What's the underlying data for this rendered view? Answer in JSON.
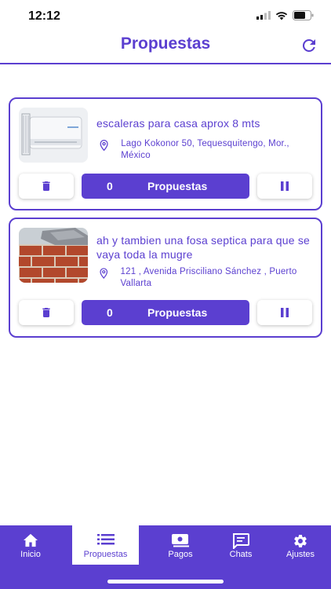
{
  "status": {
    "time": "12:12"
  },
  "header": {
    "title": "Propuestas"
  },
  "cards": [
    {
      "title": "escaleras para casa aprox 8 mts",
      "location": "Lago Kokonor 50, Tequesquitengo, Mor., México",
      "proposals_count": "0",
      "proposals_label": "Propuestas",
      "image": "air-conditioner"
    },
    {
      "title": "ah y tambien una fosa septica para que se vaya toda la mugre",
      "location": "121 , Avenida Prisciliano Sánchez , Puerto Vallarta",
      "proposals_count": "0",
      "proposals_label": "Propuestas",
      "image": "brick-wall"
    }
  ],
  "tabs": [
    {
      "label": "Inicio",
      "icon": "home-icon"
    },
    {
      "label": "Propuestas",
      "icon": "list-icon",
      "active": true
    },
    {
      "label": "Pagos",
      "icon": "payment-icon"
    },
    {
      "label": "Chats",
      "icon": "chat-icon"
    },
    {
      "label": "Ajustes",
      "icon": "gear-icon"
    }
  ],
  "colors": {
    "accent": "#5b3fd0",
    "background": "#ffffff"
  }
}
